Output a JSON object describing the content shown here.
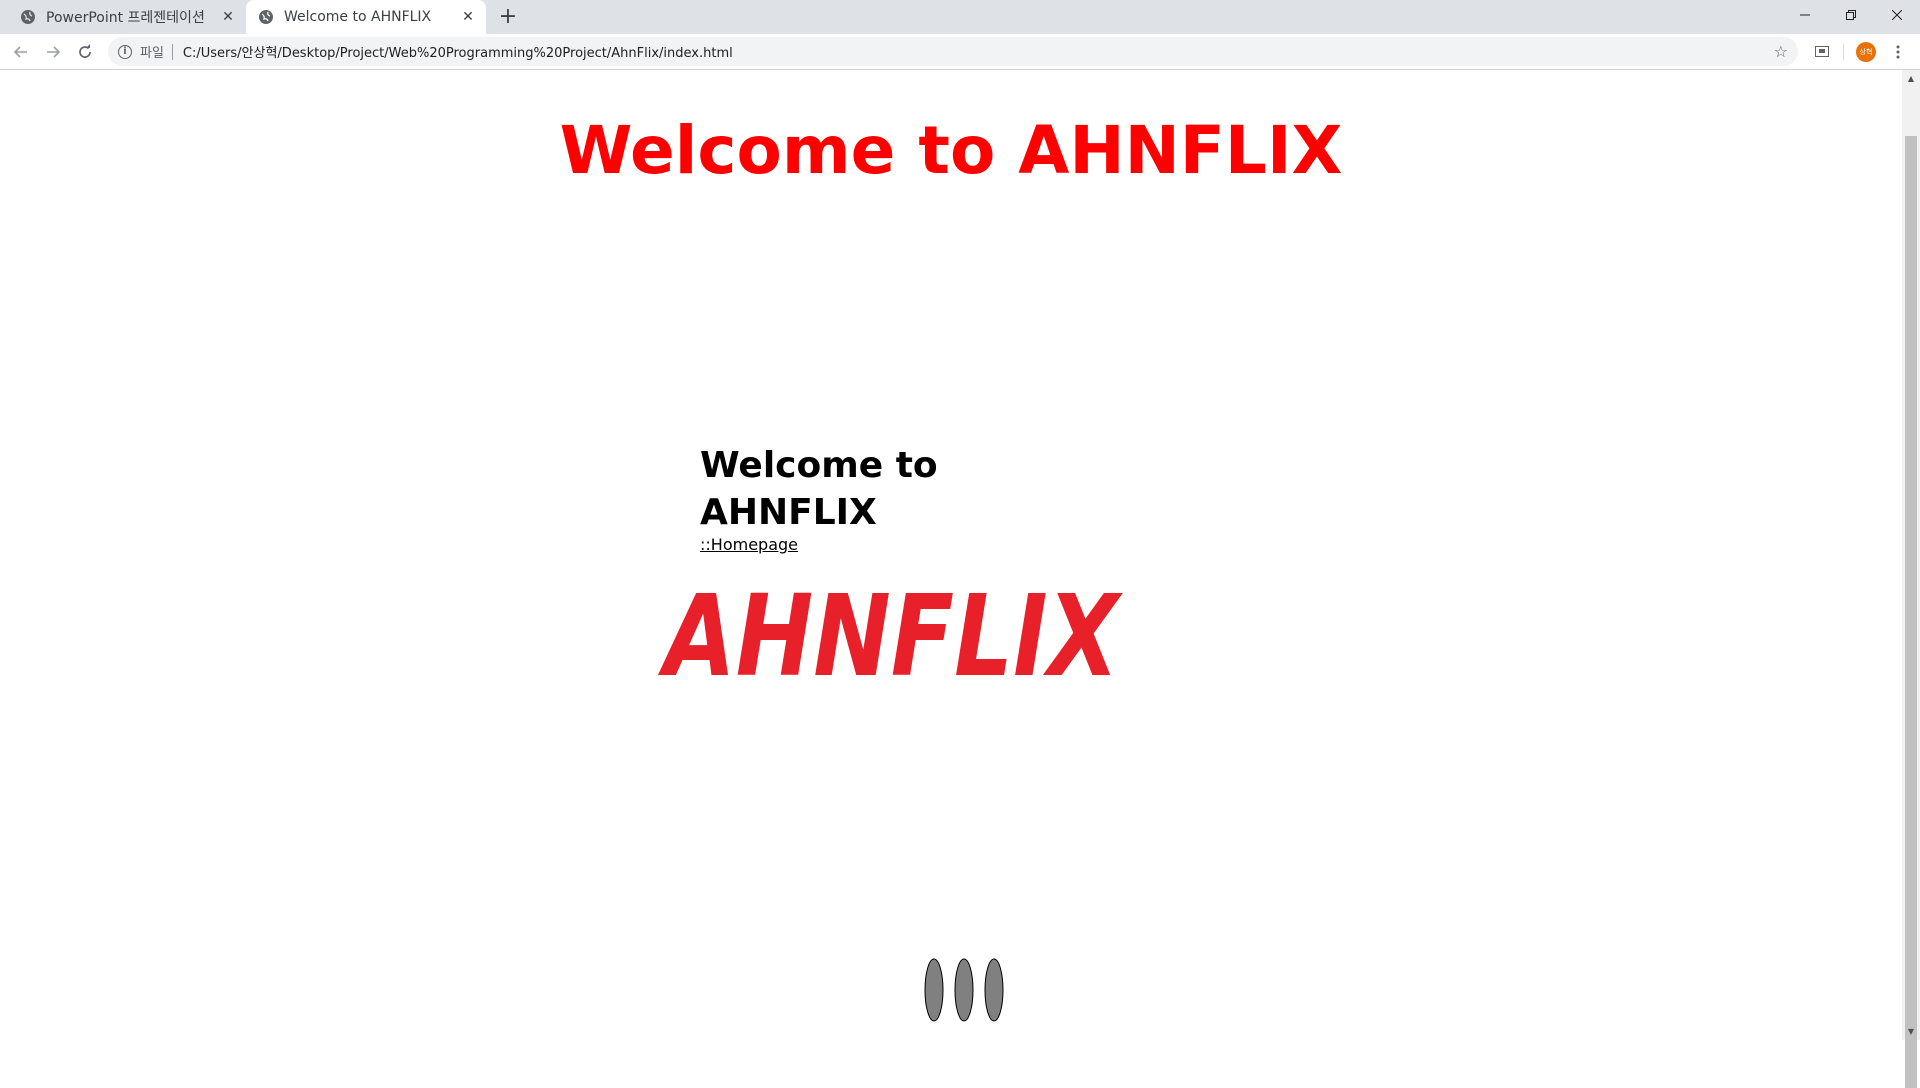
{
  "browser": {
    "tabs": [
      {
        "title": "PowerPoint 프레젠테이션",
        "active": false
      },
      {
        "title": "Welcome to AHNFLIX",
        "active": true
      }
    ],
    "new_tab_label": "+",
    "address_bar": {
      "scheme_label": "파일",
      "url": "C:/Users/안상혁/Desktop/Project/Web%20Programming%20Project/AhnFlix/index.html"
    },
    "profile_initials": "상혁",
    "icons": {
      "back": "back-arrow-icon",
      "forward": "forward-arrow-icon",
      "reload": "reload-icon",
      "info": "info-icon",
      "bookmark": "star-icon",
      "cast": "cast-icon",
      "menu": "kebab-menu-icon"
    }
  },
  "page": {
    "heading": "Welcome to AHNFLIX",
    "side_heading": "Welcome to AHNFLIX",
    "homepage_link": "::Homepage",
    "logo_text": "AHNFLIX",
    "colors": {
      "heading": "#ff0000",
      "logo": "#e8202a",
      "dots": "#808080"
    }
  }
}
